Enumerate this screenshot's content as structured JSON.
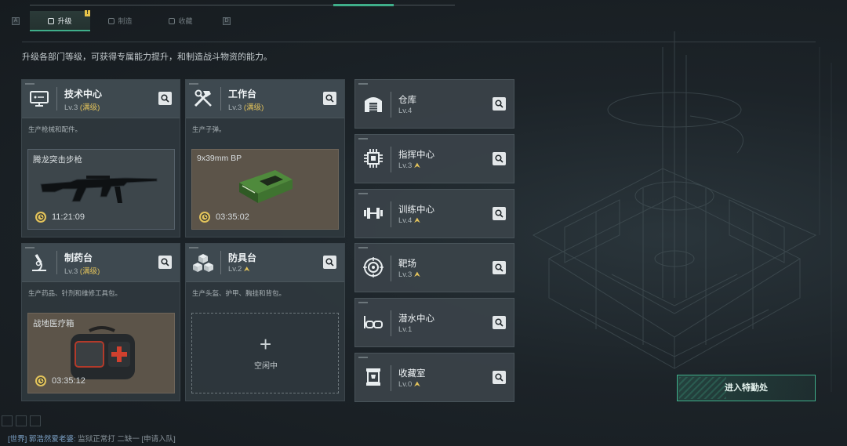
{
  "tabs": [
    {
      "label": "升级",
      "key": "A",
      "active": true
    },
    {
      "label": "制造",
      "active": false
    },
    {
      "label": "收藏",
      "active": false
    }
  ],
  "tab_next_key": "D",
  "tab_alert": "!",
  "subtitle": "升级各部门等级，可获得专属能力提升，和制造战斗物资的能力。",
  "main_cards": [
    {
      "icon": "computer-icon",
      "title": "技术中心",
      "level": "Lv.3",
      "status": "(满级)",
      "desc": "生产枪械和配件。",
      "product": {
        "name": "腾龙突击步枪",
        "time": "11:21:09",
        "image": "rifle"
      }
    },
    {
      "icon": "tools-icon",
      "title": "工作台",
      "level": "Lv.3",
      "status": "(满级)",
      "desc": "生产子弹。",
      "product": {
        "name": "9x39mm BP",
        "time": "03:35:02",
        "image": "ammo-box"
      }
    },
    {
      "icon": "microscope-icon",
      "title": "制药台",
      "level": "Lv.3",
      "status": "(满级)",
      "desc": "生产药品、针剂和维修工具包。",
      "product": {
        "name": "战地医疗箱",
        "time": "03:35:12",
        "image": "medkit"
      }
    },
    {
      "icon": "cubes-icon",
      "title": "防具台",
      "level": "Lv.2",
      "upgradable": true,
      "desc": "生产头盔、护甲、胸挂和背包。",
      "empty_text": "空闲中"
    }
  ],
  "side_cards": [
    {
      "icon": "warehouse-icon",
      "title": "仓库",
      "level": "Lv.4",
      "upgradable": false
    },
    {
      "icon": "chip-icon",
      "title": "指挥中心",
      "level": "Lv.3",
      "upgradable": true
    },
    {
      "icon": "dumbbell-icon",
      "title": "训练中心",
      "level": "Lv.4",
      "upgradable": true
    },
    {
      "icon": "target-icon",
      "title": "靶场",
      "level": "Lv.3",
      "upgradable": true
    },
    {
      "icon": "diving-mask-icon",
      "title": "潜水中心",
      "level": "Lv.1",
      "upgradable": false
    },
    {
      "icon": "trophy-icon",
      "title": "收藏室",
      "level": "Lv.0",
      "upgradable": true
    }
  ],
  "enter_button": "进入特勤处",
  "chat": {
    "channel": "[世界]",
    "name": "郭浩然爱老婆:",
    "message": "监狱正常打 二缺一",
    "action": "[申请入队]"
  },
  "colors": {
    "accent": "#3fae8a",
    "max_level": "#e3c35b",
    "background": "#1b2126"
  }
}
